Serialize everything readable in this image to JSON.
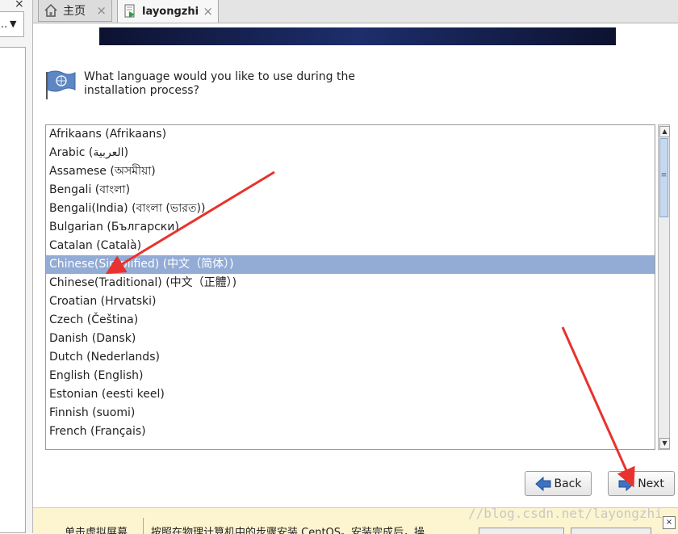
{
  "sidebar": {
    "close_glyph": "×",
    "select_dots": "..",
    "select_arrow": "▼"
  },
  "tabs": [
    {
      "label": "主页",
      "icon": "home-icon",
      "close": "×"
    },
    {
      "label": "layongzhi",
      "icon": "vm-icon",
      "close": "×"
    }
  ],
  "installer": {
    "question": "What language would you like to use during the installation process?",
    "languages": [
      "Afrikaans (Afrikaans)",
      "Arabic (العربية)",
      "Assamese (অসমীয়া)",
      "Bengali (বাংলা)",
      "Bengali(India) (বাংলা (ভারত))",
      "Bulgarian (Български)",
      "Catalan (Català)",
      "Chinese(Simplified) (中文（简体）)",
      "Chinese(Traditional) (中文（正體）)",
      "Croatian (Hrvatski)",
      "Czech (Čeština)",
      "Danish (Dansk)",
      "Dutch (Nederlands)",
      "English (English)",
      "Estonian (eesti keel)",
      "Finnish (suomi)",
      "French (Français)"
    ],
    "selected_index": 7,
    "back_label": "Back",
    "next_label": "Next",
    "scroll_up": "▲",
    "scroll_down": "▼",
    "scroll_grip": "≡"
  },
  "hintbar": {
    "left_text": "单击虚拟屏幕",
    "right_text": "按照在物理计算机中的步骤安装 CentOS。安装完成后，操",
    "close_glyph": "×"
  },
  "watermark": "//blog.csdn.net/layongzhi",
  "colors": {
    "selection": "#93acd6",
    "arrow_annotation": "#e8322d",
    "hintbar_bg": "#fdf5d0"
  }
}
